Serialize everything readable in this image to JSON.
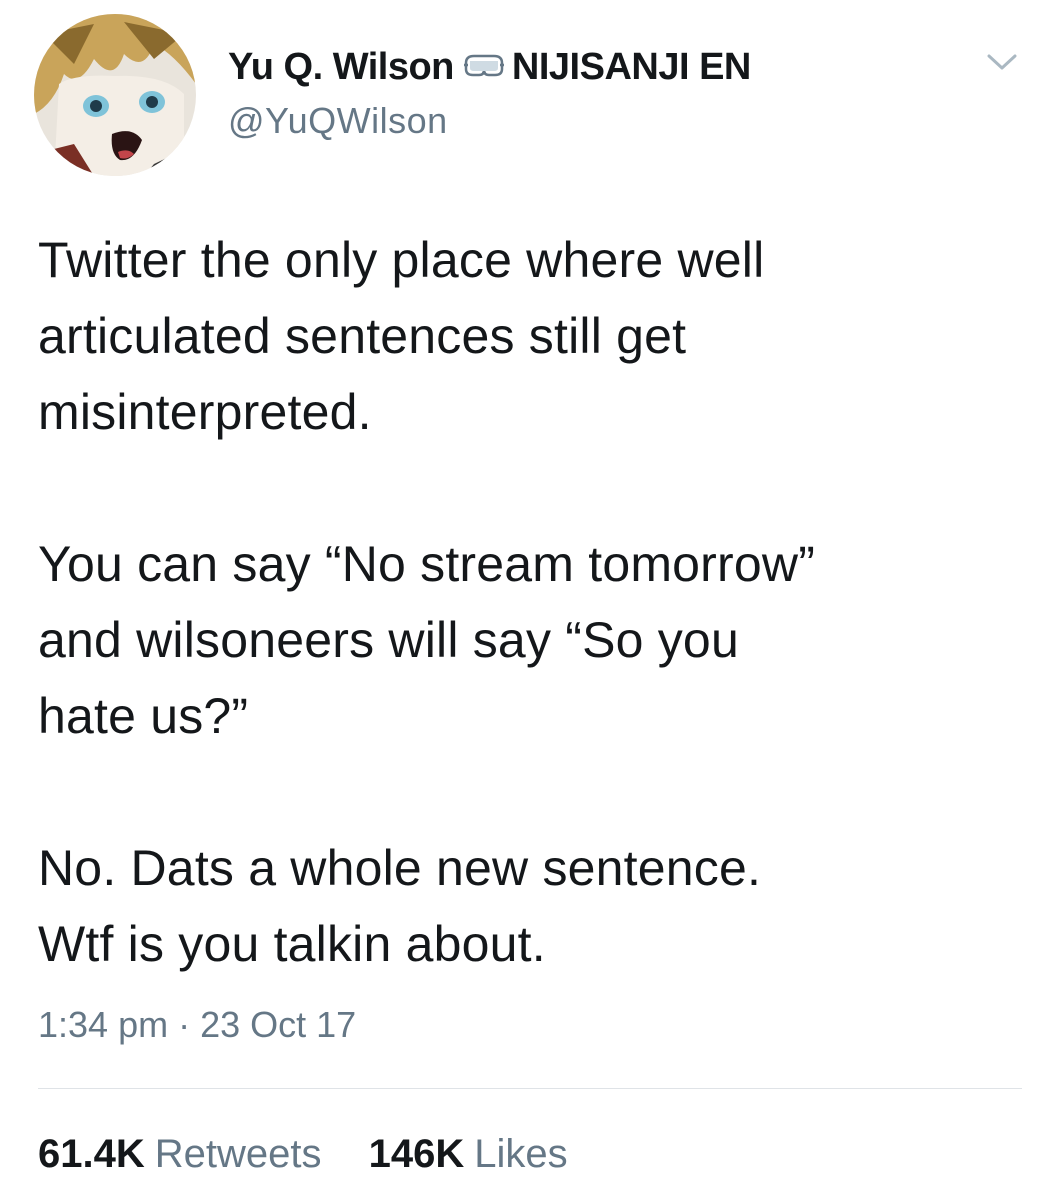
{
  "user": {
    "display_name": "Yu Q. Wilson",
    "badge_icon": "goggles-icon",
    "affiliation": "NIJISANJI EN",
    "handle": "@YuQWilson"
  },
  "tweet": {
    "paragraphs": [
      "Twitter the only place where well\narticulated sentences still get\nmisinterpreted.",
      "You can say “No stream tomorrow”\nand wilsoneers will say “So you\nhate us?”",
      "No. Dats a whole new sentence.\nWtf is you talkin about."
    ],
    "time": "1:34 pm",
    "separator": "·",
    "date": "23 Oct 17"
  },
  "stats": {
    "retweets_count": "61.4K",
    "retweets_label": "Retweets",
    "likes_count": "146K",
    "likes_label": "Likes"
  },
  "colors": {
    "text": "#14171a",
    "muted": "#657786",
    "divider": "#dfe3e7"
  }
}
